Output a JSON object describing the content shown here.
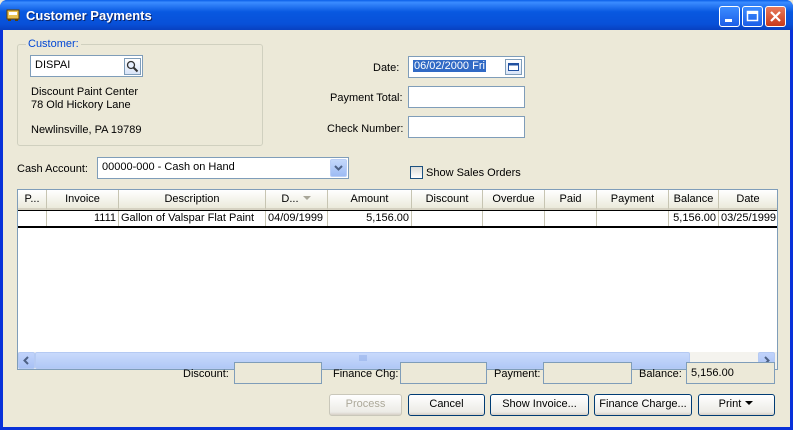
{
  "window": {
    "title": "Customer Payments"
  },
  "customer": {
    "group_label": "Customer:",
    "id": "DISPAI",
    "name": "Discount Paint Center",
    "address1": "78 Old Hickory Lane",
    "city_state_zip": "Newlinsville, PA 19789"
  },
  "form": {
    "date_label": "Date:",
    "date_value": "06/02/2000 Fri",
    "payment_total_label": "Payment Total:",
    "payment_total_value": "",
    "check_number_label": "Check Number:",
    "check_number_value": "",
    "cash_account_label": "Cash Account:",
    "cash_account_value": "00000-000 - Cash on Hand",
    "show_sales_orders_label": "Show Sales Orders",
    "show_sales_orders_checked": false
  },
  "grid": {
    "columns": [
      "P...",
      "Invoice",
      "Description",
      "D...",
      "Amount",
      "Discount",
      "Overdue",
      "Paid",
      "Payment",
      "Balance",
      "Date"
    ],
    "rows": [
      {
        "p": "",
        "invoice": "1111",
        "description": "Gallon of Valspar Flat Paint",
        "d": "04/09/1999",
        "amount": "5,156.00",
        "discount": "",
        "overdue": "",
        "paid": "",
        "payment": "",
        "balance": "5,156.00",
        "date": "03/25/1999"
      }
    ]
  },
  "totals": {
    "discount_label": "Discount:",
    "discount_value": "",
    "finance_chg_label": "Finance Chg:",
    "finance_chg_value": "",
    "payment_label": "Payment:",
    "payment_value": "",
    "balance_label": "Balance:",
    "balance_value": "5,156.00"
  },
  "buttons": {
    "process": "Process",
    "cancel": "Cancel",
    "show_invoice": "Show Invoice...",
    "finance_charge": "Finance Charge...",
    "print": "Print"
  }
}
